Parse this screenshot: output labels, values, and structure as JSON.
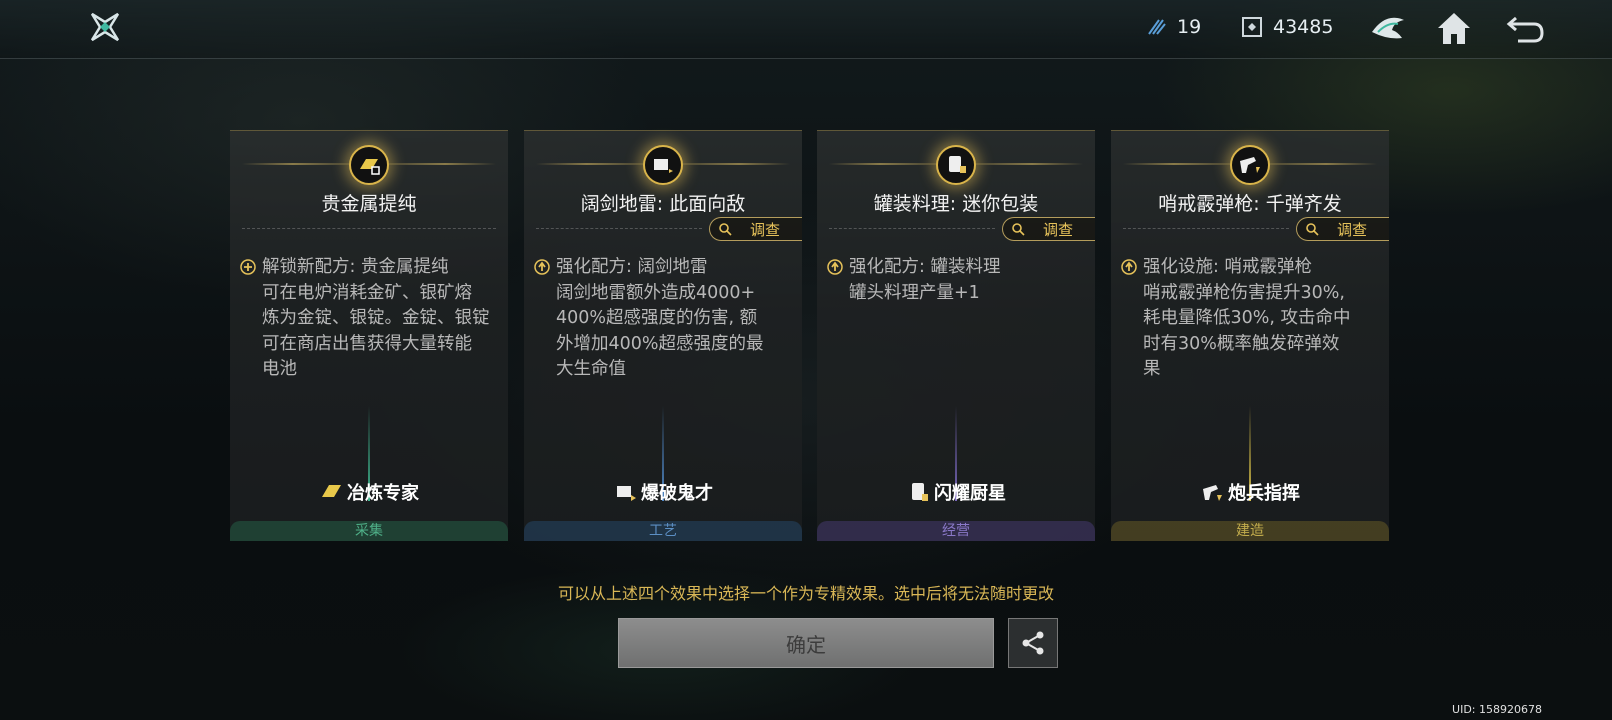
{
  "topbar": {
    "energy": "19",
    "coins": "43485",
    "icons": [
      "logo-icon",
      "energy-icon",
      "coin-icon",
      "wing-icon",
      "home-icon",
      "back-icon"
    ]
  },
  "cards": [
    {
      "title": "贵金属提纯",
      "inspect": "",
      "desc_lines": [
        "解锁新配方: 贵金属提纯",
        "可在电炉消耗金矿、银矿熔",
        "炼为金锭、银锭。金锭、银锭",
        "可在商店出售获得大量转能",
        "电池"
      ],
      "spec": "冶炼专家",
      "category": "采集",
      "color": "#2e7d5a",
      "icon": "gold-ingot-icon"
    },
    {
      "title": "阔剑地雷: 此面向敌",
      "inspect": "调查",
      "desc_lines": [
        "强化配方: 阔剑地雷",
        "阔剑地雷额外造成4000+",
        "400%超感强度的伤害, 额",
        "外增加400%超感强度的最",
        "大生命值"
      ],
      "spec": "爆破鬼才",
      "category": "工艺",
      "color": "#2f5f8a",
      "icon": "mine-icon"
    },
    {
      "title": "罐装料理: 迷你包装",
      "inspect": "调查",
      "desc_lines": [
        "强化配方: 罐装料理",
        "罐头料理产量+1"
      ],
      "spec": "闪耀厨星",
      "category": "经营",
      "color": "#5a4a8a",
      "icon": "can-icon"
    },
    {
      "title": "哨戒霰弹枪: 千弹齐发",
      "inspect": "调查",
      "desc_lines": [
        "强化设施: 哨戒霰弹枪",
        "哨戒霰弹枪伤害提升30%,",
        "耗电量降低30%, 攻击命中",
        "时有30%概率触发碎弹效",
        "果"
      ],
      "spec": "炮兵指挥",
      "category": "建造",
      "color": "#8a7a2a",
      "icon": "turret-icon"
    }
  ],
  "hint": "可以从上述四个效果中选择一个作为专精效果。选中后将无法随时更改",
  "confirm_label": "确定",
  "uid": "UID: 158920678"
}
